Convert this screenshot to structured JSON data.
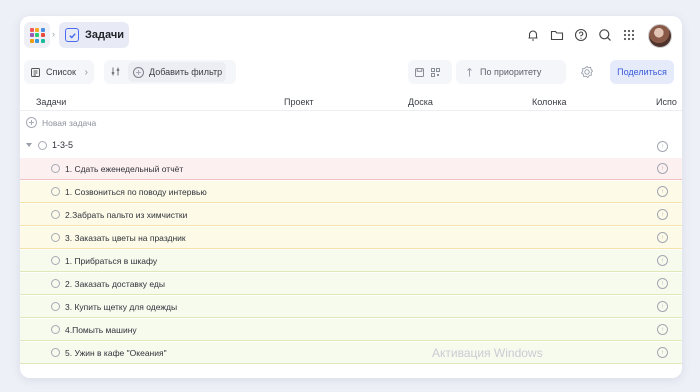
{
  "header": {
    "title": "Задачи",
    "icons": [
      "apps-grid-icon",
      "bell-icon",
      "folder-icon",
      "help-icon",
      "search-icon",
      "more-grid-icon"
    ],
    "apps_colors": [
      "#f25a5a",
      "#f5a623",
      "#4a90e2",
      "#9b59b6",
      "#2ecc71",
      "#e74c3c",
      "#f39c12",
      "#3498db",
      "#1abc9c"
    ]
  },
  "toolbar": {
    "view_label": "Список",
    "add_filter_label": "Добавить фильтр",
    "sort_label": "По приоритету",
    "share_label": "Поделиться"
  },
  "table": {
    "columns": [
      "Задачи",
      "Проект",
      "Доска",
      "Колонка",
      "Испо"
    ],
    "new_task_label": "Новая задача",
    "group_label": "1-3-5",
    "rows": [
      {
        "title": "1. Сдать еженедельный отчёт",
        "color": "#fdf0f0",
        "border": "#f2c0c0"
      },
      {
        "title": "1. Созвониться по поводу интервью",
        "color": "#fdfbe8",
        "border": "#f4e3a4"
      },
      {
        "title": "2.Забрать пальто из химчистки",
        "color": "#fdfbe8",
        "border": "#f4e3a4"
      },
      {
        "title": "3. Заказать цветы на праздник",
        "color": "#fdfbe8",
        "border": "#f4e3a4"
      },
      {
        "title": "1. Прибраться в шкафу",
        "color": "#f7fbee",
        "border": "#dceab7"
      },
      {
        "title": "2. Заказать доставку еды",
        "color": "#f7fbee",
        "border": "#dceab7"
      },
      {
        "title": "3. Купить щетку для одежды",
        "color": "#f7fbee",
        "border": "#dceab7"
      },
      {
        "title": "4.Помыть машину",
        "color": "#f7fbee",
        "border": "#dceab7"
      },
      {
        "title": "5. Ужин в кафе \"Океания\"",
        "color": "#f7fbee",
        "border": "#dceab7"
      }
    ]
  },
  "watermark": "Активация Windows"
}
